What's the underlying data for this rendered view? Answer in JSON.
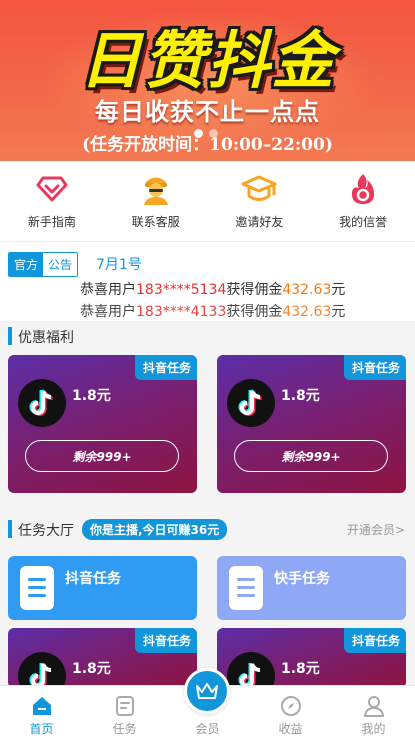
{
  "banner": {
    "title": "日赞抖金",
    "subtitle": "每日收获不止一点点",
    "time_text": "(任务开放时间：10:00–22:00)"
  },
  "quick_menu": [
    {
      "label": "新手指南",
      "icon": "diamond-icon",
      "color": "#e8395c"
    },
    {
      "label": "联系客服",
      "icon": "agent-icon",
      "color": "#f5a623"
    },
    {
      "label": "邀请好友",
      "icon": "graduation-cap-icon",
      "color": "#f5a623"
    },
    {
      "label": "我的信誉",
      "icon": "flame-icon",
      "color": "#e8395c"
    }
  ],
  "notice": {
    "tab_official": "官方",
    "tab_announcement": "公告",
    "date": "7月1号",
    "lines": [
      {
        "prefix": "恭喜用户",
        "phone": "183****5134",
        "mid": "获得佣金",
        "amount": "432.63",
        "suffix": "元"
      },
      {
        "prefix": "恭喜用户",
        "phone": "183****4133",
        "mid": "获得佣金",
        "amount": "432.63",
        "suffix": "元"
      }
    ]
  },
  "benefits": {
    "title": "优惠福利",
    "cards": [
      {
        "tag": "抖音任务",
        "price": "1.8元",
        "remain": "剩余999+"
      },
      {
        "tag": "抖音任务",
        "price": "1.8元",
        "remain": "剩余999+"
      }
    ]
  },
  "task_hall": {
    "title": "任务大厅",
    "pill": "你是主播,今日可赚36元",
    "more": "开通会员>",
    "categories": [
      {
        "name": "抖音任务"
      },
      {
        "name": "快手任务"
      }
    ],
    "cards": [
      {
        "tag": "抖音任务",
        "price": "1.8元"
      },
      {
        "tag": "抖音任务",
        "price": "1.8元"
      }
    ]
  },
  "bottom_nav": [
    {
      "label": "首页",
      "icon": "home-icon",
      "active": true
    },
    {
      "label": "任务",
      "icon": "task-icon",
      "active": false
    },
    {
      "label": "会员",
      "icon": "crown-icon",
      "active": false
    },
    {
      "label": "收益",
      "icon": "compass-icon",
      "active": false
    },
    {
      "label": "我的",
      "icon": "user-icon",
      "active": false
    }
  ],
  "colors": {
    "accent": "#1296db",
    "banner": "#f4553f",
    "price_red": "#e8322b",
    "amount_orange": "#f07a1d"
  }
}
